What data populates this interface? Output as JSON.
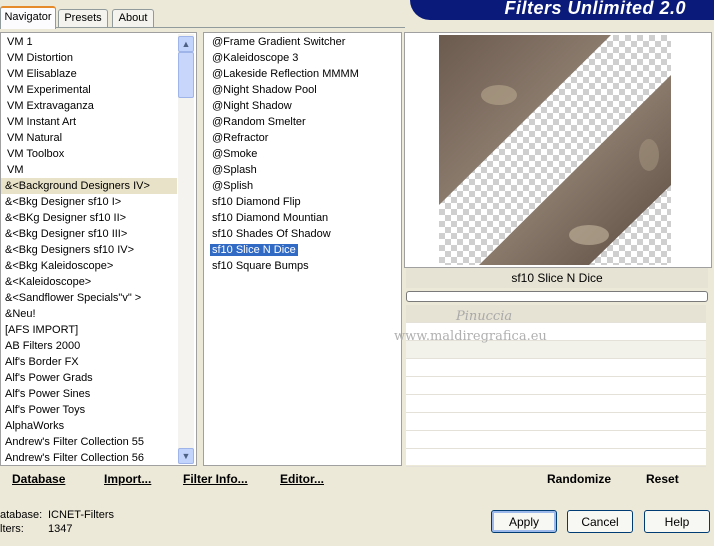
{
  "tabs": [
    {
      "label": "Navigator",
      "active": true
    },
    {
      "label": "Presets",
      "active": false
    },
    {
      "label": "About",
      "active": false
    }
  ],
  "banner_title": "Filters Unlimited 2.0",
  "categories": [
    "VM 1",
    "VM Distortion",
    "VM Elisablaze",
    "VM Experimental",
    "VM Extravaganza",
    "VM Instant Art",
    "VM Natural",
    "VM Toolbox",
    "VM",
    "&<Background Designers IV>",
    "&<Bkg Designer sf10 I>",
    "&<BKg Designer sf10 II>",
    "&<Bkg Designer sf10 III>",
    "&<Bkg Designers sf10 IV>",
    "&<Bkg Kaleidoscope>",
    "&<Kaleidoscope>",
    "&<Sandflower Specials\"v\" >",
    "&Neu!",
    "[AFS IMPORT]",
    "AB Filters 2000",
    "Alf's Border FX",
    "Alf's Power Grads",
    "Alf's Power Sines",
    "Alf's Power Toys",
    "AlphaWorks",
    "Andrew's Filter Collection 55",
    "Andrew's Filter Collection 56"
  ],
  "highlighted_category": "&<Background Designers IV>",
  "filters": [
    "@Frame Gradient Switcher",
    "@Kaleidoscope 3",
    "@Lakeside Reflection MMMM",
    "@Night Shadow Pool",
    "@Night Shadow",
    "@Random Smelter",
    "@Refractor",
    "@Smoke",
    "@Splash",
    "@Splish",
    "sf10 Diamond Flip",
    "sf10 Diamond Mountian",
    "sf10 Shades Of Shadow",
    "sf10 Slice N Dice",
    "sf10 Square Bumps"
  ],
  "selected_filter": "sf10 Slice N Dice",
  "preview": {
    "filter_name": "sf10 Slice N Dice",
    "progress_fraction": 0
  },
  "watermark": {
    "line1": "Pinuccia",
    "line2": "www.maldiregrafica.eu"
  },
  "link_buttons": {
    "database": "Database",
    "import": "Import...",
    "filter_info": "Filter Info...",
    "editor": "Editor...",
    "randomize": "Randomize",
    "reset": "Reset"
  },
  "status": {
    "database_label": "atabase:",
    "database_value": "ICNET-Filters",
    "filters_label": "lters:",
    "filters_value": "1347"
  },
  "buttons": {
    "apply": "Apply",
    "cancel": "Cancel",
    "help": "Help"
  },
  "icons": {
    "scroll_up": "scroll-up-arrow-icon",
    "scroll_down": "scroll-down-arrow-icon"
  },
  "colors": {
    "selection": "#316ac5",
    "banner": "#0a1a7a",
    "tab_accent": "#e68b2c"
  }
}
